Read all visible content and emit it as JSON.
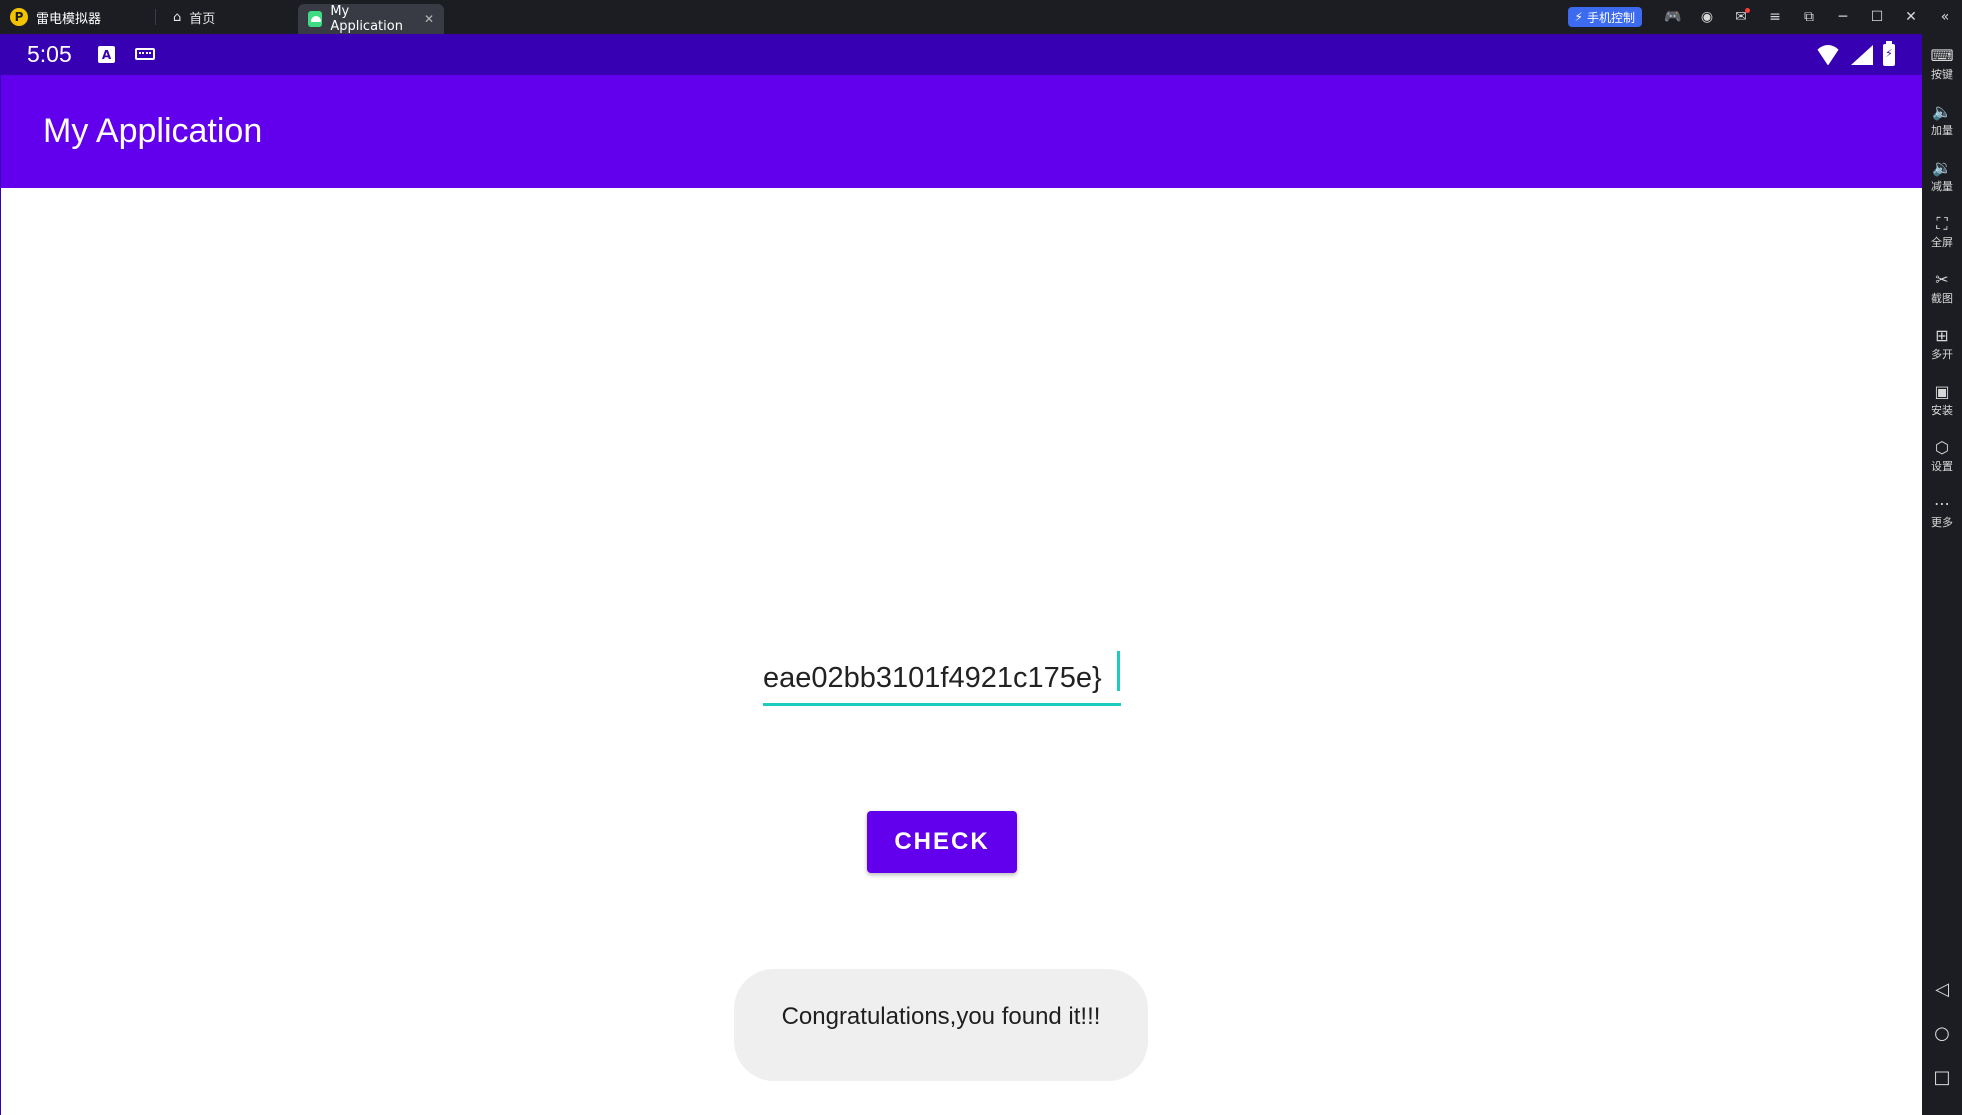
{
  "emulator": {
    "name": "雷电模拟器",
    "tabs": [
      {
        "label": "首页",
        "icon": "home-icon"
      },
      {
        "label": "My Application",
        "icon": "android-app-icon",
        "active": true
      }
    ],
    "phone_control_label": "手机控制",
    "sidebar": [
      {
        "label": "按键",
        "icon": "keyboard-icon"
      },
      {
        "label": "加量",
        "icon": "volume-up-icon"
      },
      {
        "label": "减量",
        "icon": "volume-down-icon"
      },
      {
        "label": "全屏",
        "icon": "fullscreen-icon"
      },
      {
        "label": "截图",
        "icon": "scissors-icon"
      },
      {
        "label": "多开",
        "icon": "multi-instance-icon"
      },
      {
        "label": "安装",
        "icon": "apk-install-icon"
      },
      {
        "label": "设置",
        "icon": "settings-icon"
      },
      {
        "label": "更多",
        "icon": "more-icon"
      }
    ]
  },
  "statusbar": {
    "time": "5:05",
    "notification_letter": "A"
  },
  "app": {
    "title": "My Application",
    "input_value": "eae02bb3101f4921c175e}",
    "check_button": "CHECK",
    "toast": "Congratulations,you found it!!!"
  },
  "colors": {
    "primary": "#6200ee",
    "primary_dark": "#3700b3",
    "accent": "#1ecbc0"
  }
}
